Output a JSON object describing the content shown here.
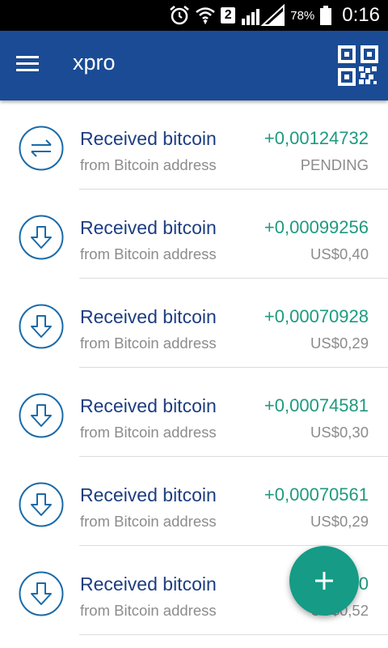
{
  "status_bar": {
    "battery_percent": "78%",
    "time": "0:16",
    "sim_slot": "2",
    "icons": [
      "alarm-icon",
      "wifi-icon",
      "sim-icon",
      "signal-icon",
      "battery-icon"
    ]
  },
  "app_bar": {
    "title": "xpro",
    "menu_icon": "menu-icon",
    "qr_icon": "qr-code-icon"
  },
  "transactions": [
    {
      "title": "Received bitcoin",
      "subtitle": "from Bitcoin address",
      "amount": "+0,00124732",
      "secondary": "PENDING",
      "icon": "pending-transfer-icon"
    },
    {
      "title": "Received bitcoin",
      "subtitle": "from Bitcoin address",
      "amount": "+0,00099256",
      "secondary": "US$0,40",
      "icon": "received-icon"
    },
    {
      "title": "Received bitcoin",
      "subtitle": "from Bitcoin address",
      "amount": "+0,00070928",
      "secondary": "US$0,29",
      "icon": "received-icon"
    },
    {
      "title": "Received bitcoin",
      "subtitle": "from Bitcoin address",
      "amount": "+0,00074581",
      "secondary": "US$0,30",
      "icon": "received-icon"
    },
    {
      "title": "Received bitcoin",
      "subtitle": "from Bitcoin address",
      "amount": "+0,00070561",
      "secondary": "US$0,29",
      "icon": "received-icon"
    },
    {
      "title": "Received bitcoin",
      "subtitle": "from Bitcoin address",
      "amount": "+0,00",
      "secondary": "US$0,52",
      "icon": "received-icon"
    }
  ],
  "fab": {
    "icon": "plus-icon"
  },
  "colors": {
    "app_bar": "#1a4b94",
    "title_text": "#1c3d80",
    "amount_positive": "#1e9a7f",
    "fab": "#159b86",
    "secondary_text": "#8c8c8c"
  }
}
